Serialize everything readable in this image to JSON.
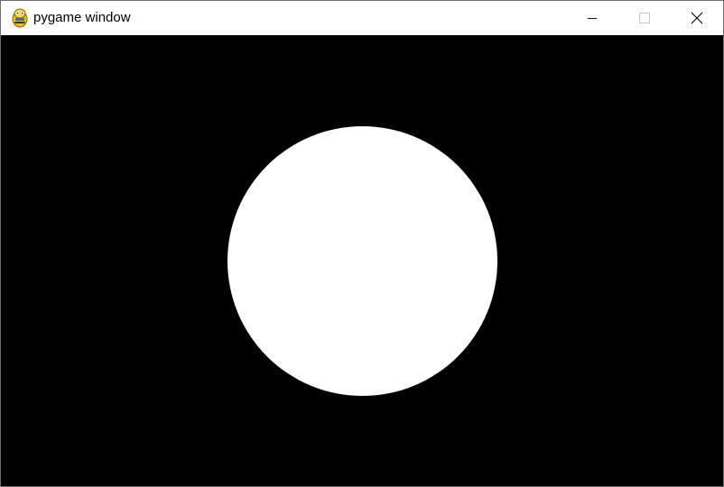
{
  "window": {
    "title": "pygame window",
    "app_icon": "pygame-snake-icon",
    "controls": {
      "minimize_icon": "minimize-icon",
      "maximize_icon": "maximize-icon",
      "close_icon": "close-icon"
    }
  },
  "canvas": {
    "background_color": "#000000",
    "shape": {
      "type": "circle",
      "color": "#ffffff"
    }
  },
  "colors": {
    "titlebar": "#ffffff",
    "title_text": "#000000",
    "disabled_control": "#c8c8c8"
  }
}
